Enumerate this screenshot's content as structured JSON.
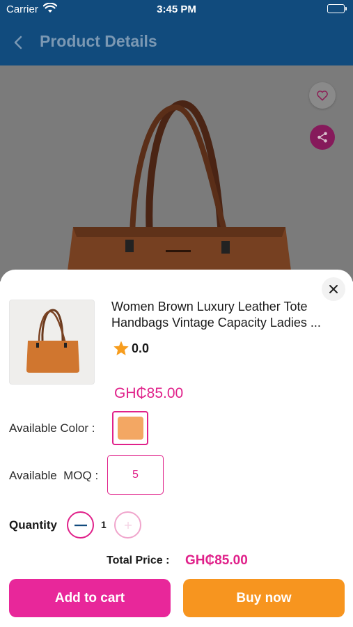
{
  "status_bar": {
    "carrier": "Carrier",
    "time": "3:45 PM"
  },
  "nav": {
    "title": "Product Details"
  },
  "product": {
    "name_line1": "Women Brown Luxury Leather Tote",
    "name_line2": "Handbags Vintage Capacity Ladies ...",
    "rating": "0.0",
    "price": "GH₵85.00"
  },
  "options": {
    "color_label": "Available Color :",
    "moq_label": "Available  MOQ :",
    "moq_value": "5",
    "swatch_color": "#f3a763"
  },
  "quantity": {
    "label": "Quantity",
    "value": "1"
  },
  "total": {
    "label": "Total Price :",
    "value": "GH₵85.00"
  },
  "actions": {
    "add_to_cart": "Add to cart",
    "buy_now": "Buy now"
  },
  "colors": {
    "header": "#114b7d",
    "accent": "#e0218a",
    "buy": "#f7951f",
    "cart": "#e8279a"
  }
}
